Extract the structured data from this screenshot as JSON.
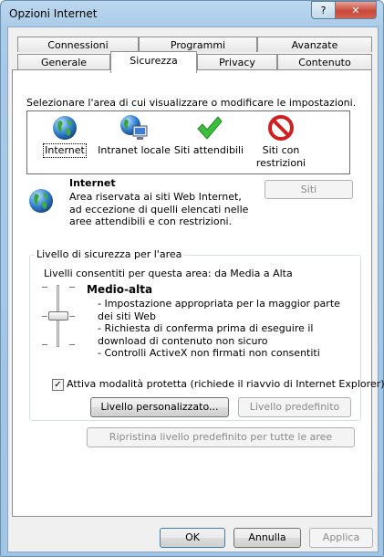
{
  "window": {
    "title": "Opzioni Internet",
    "help_glyph": "?",
    "close_glyph": "✕"
  },
  "tabs_top": [
    "Connessioni",
    "Programmi",
    "Avanzate"
  ],
  "tabs_bottom": [
    "Generale",
    "Sicurezza",
    "Privacy",
    "Contenuto"
  ],
  "active_tab": "Sicurezza",
  "security": {
    "instruction": "Selezionare l'area di cui visualizzare o modificare le impostazioni.",
    "zones": [
      {
        "label": "Internet",
        "icon": "globe-icon"
      },
      {
        "label": "Intranet locale",
        "icon": "intranet-icon"
      },
      {
        "label": "Siti attendibili",
        "icon": "checkmark-icon"
      },
      {
        "label": "Siti con\nrestrizioni",
        "icon": "restricted-icon"
      }
    ],
    "selected_zone": "Internet",
    "zone_title": "Internet",
    "zone_description": "Area riservata ai siti Web Internet, ad eccezione di quelli elencati nelle aree attendibili e con restrizioni.",
    "sites_button": "Siti",
    "level_group_title": "Livello di sicurezza per l'area",
    "allowed_levels": "Livelli consentiti per questa area: da Media a Alta",
    "level_name": "Medio-alta",
    "level_bullets": [
      "- Impostazione appropriata per la maggior parte dei siti Web",
      "- Richiesta di conferma prima di eseguire il download di contenuto non sicuro",
      "- Controlli ActiveX non firmati non consentiti"
    ],
    "protected_mode_label": "Attiva modalità protetta (richiede il riavvio di Internet Explorer)",
    "protected_mode_checked": true,
    "check_glyph": "✓",
    "custom_level_button": "Livello personalizzato...",
    "default_level_button": "Livello predefinito",
    "reset_all_button": "Ripristina livello predefinito per tutte le aree"
  },
  "footer": {
    "ok": "OK",
    "cancel": "Annulla",
    "apply": "Applica"
  }
}
